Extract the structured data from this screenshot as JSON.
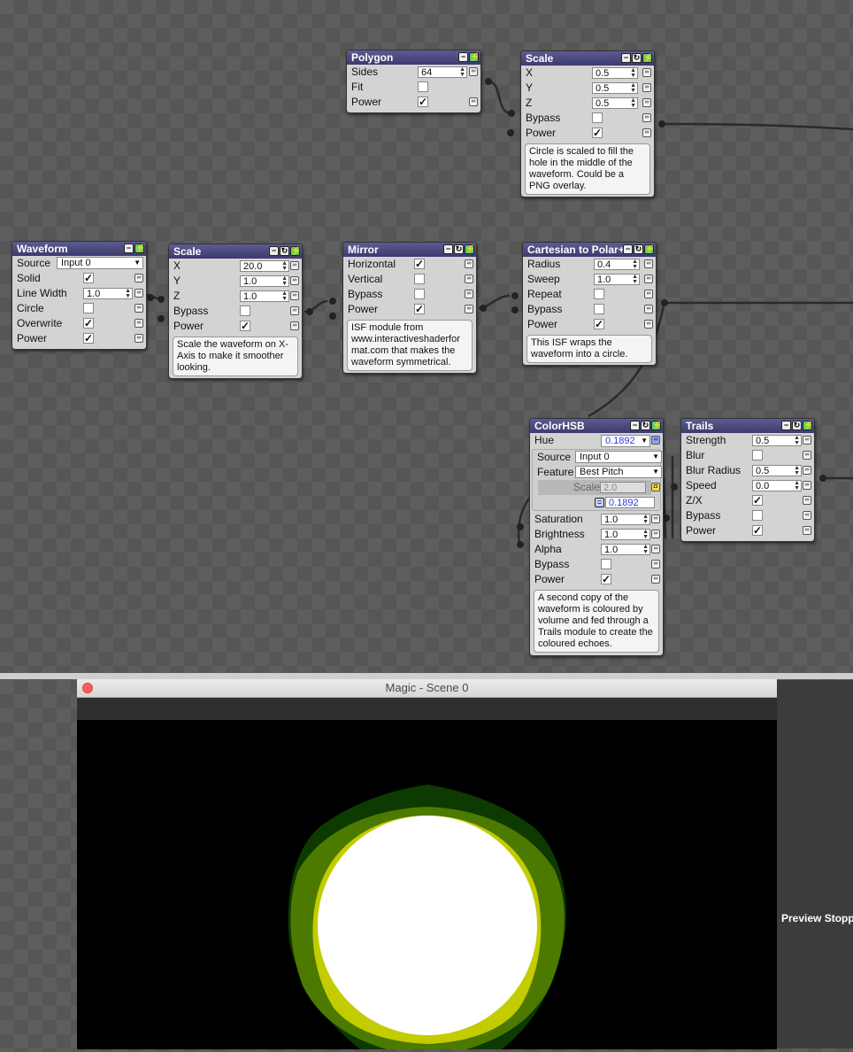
{
  "polygon": {
    "title": "Polygon",
    "sides_label": "Sides",
    "sides": "64",
    "fit_label": "Fit",
    "power_label": "Power"
  },
  "scale_top": {
    "title": "Scale",
    "x_label": "X",
    "x": "0.5",
    "y_label": "Y",
    "y": "0.5",
    "z_label": "Z",
    "z": "0.5",
    "bypass_label": "Bypass",
    "power_label": "Power",
    "note": "Circle is scaled to fill the hole in the middle of the waveform. Could be a PNG overlay."
  },
  "waveform": {
    "title": "Waveform",
    "source_label": "Source",
    "source": "Input 0",
    "solid_label": "Solid",
    "linewidth_label": "Line Width",
    "linewidth": "1.0",
    "circle_label": "Circle",
    "overwrite_label": "Overwrite",
    "power_label": "Power"
  },
  "scale_mid": {
    "title": "Scale",
    "x_label": "X",
    "x": "20.0",
    "y_label": "Y",
    "y": "1.0",
    "z_label": "Z",
    "z": "1.0",
    "bypass_label": "Bypass",
    "power_label": "Power",
    "note": "Scale the waveform on X-Axis to make it smoother looking."
  },
  "mirror": {
    "title": "Mirror",
    "horizontal_label": "Horizontal",
    "vertical_label": "Vertical",
    "bypass_label": "Bypass",
    "power_label": "Power",
    "note": "ISF module from www.interactiveshaderfor mat.com that makes the waveform symmetrical."
  },
  "polar": {
    "title": "Cartesian to Polar+",
    "radius_label": "Radius",
    "radius": "0.4",
    "sweep_label": "Sweep",
    "sweep": "1.0",
    "repeat_label": "Repeat",
    "bypass_label": "Bypass",
    "power_label": "Power",
    "note": "This ISF wraps the waveform into a circle."
  },
  "colorhsb": {
    "title": "ColorHSB",
    "hue_label": "Hue",
    "hue": "0.1892",
    "source_label": "Source",
    "source": "Input 0",
    "feature_label": "Feature",
    "feature": "Best Pitch",
    "scale_label": "Scale",
    "scale": "2.0",
    "eq_value": "0.1892",
    "saturation_label": "Saturation",
    "saturation": "1.0",
    "brightness_label": "Brightness",
    "brightness": "1.0",
    "alpha_label": "Alpha",
    "alpha": "1.0",
    "bypass_label": "Bypass",
    "power_label": "Power",
    "note": "A second copy of the waveform is coloured by volume and fed through a Trails module to create the coloured echoes."
  },
  "trails": {
    "title": "Trails",
    "strength_label": "Strength",
    "strength": "0.5",
    "blur_label": "Blur",
    "blurradius_label": "Blur Radius",
    "blurradius": "0.5",
    "speed_label": "Speed",
    "speed": "0.0",
    "zx_label": "Z/X",
    "bypass_label": "Bypass",
    "power_label": "Power"
  },
  "preview": {
    "title": "Magic - Scene 0",
    "stopped": "Preview Stopped"
  },
  "colors": {
    "node_header": "#3b3b6e",
    "power_on": "#5fd45f",
    "ring_dark": "#4a7a00",
    "ring_yellow": "#c5cf00"
  }
}
